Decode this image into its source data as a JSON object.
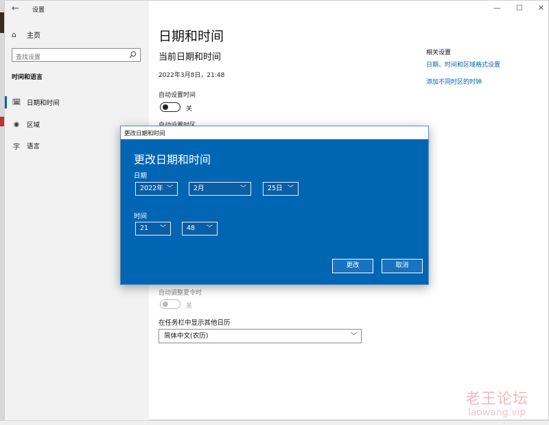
{
  "window": {
    "app_title": "设置",
    "controls": [
      "—",
      "☐",
      "✕"
    ]
  },
  "sidebar": {
    "home_label": "主页",
    "search_placeholder": "查找设置",
    "section_title": "时间和语言",
    "items": [
      {
        "label": "日期和时间",
        "icon": "calendar-clock-icon",
        "active": true
      },
      {
        "label": "区域",
        "icon": "globe-region-icon",
        "active": false
      },
      {
        "label": "语言",
        "icon": "language-icon",
        "active": false
      }
    ]
  },
  "main": {
    "page_title": "日期和时间",
    "sub_title": "当前日期和时间",
    "current_datetime": "2022年3月8日，21:48",
    "auto_time_label": "自动设置时间",
    "auto_time_state": "关",
    "auto_zone_label": "自动设置时区",
    "dst_label": "自动调整夏令时",
    "dst_state": "关",
    "calendar_label": "在任务栏中显示其他日历",
    "calendar_value": "简体中文(农历)"
  },
  "related": {
    "title": "相关设置",
    "links": [
      "日期、时间和区域格式设置",
      "添加不同时区的时钟"
    ]
  },
  "dialog": {
    "window_title": "更改日期和时间",
    "heading": "更改日期和时间",
    "date_label": "日期",
    "year": "2022年",
    "month": "2月",
    "day": "25日",
    "time_label": "时间",
    "hour": "21",
    "minute": "48",
    "change_button": "更改",
    "cancel_button": "取消"
  },
  "watermark": {
    "cn": "老王论坛",
    "en": "laowang.vip"
  },
  "colors": {
    "accent": "#0063b1",
    "dialog_bg": "#0066b4",
    "sidebar_bg": "#f2f2f2"
  }
}
